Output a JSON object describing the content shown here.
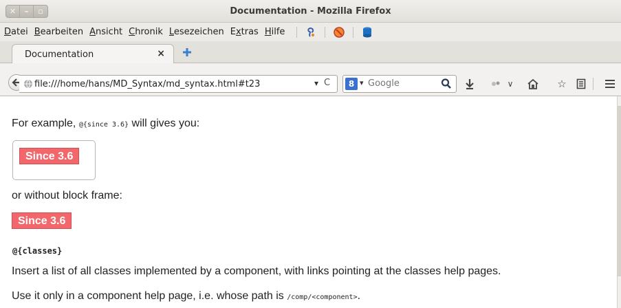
{
  "window": {
    "title": "Documentation - Mozilla Firefox"
  },
  "menubar": {
    "items": [
      {
        "pre": "",
        "u": "D",
        "post": "atei"
      },
      {
        "pre": "",
        "u": "B",
        "post": "earbeiten"
      },
      {
        "pre": "",
        "u": "A",
        "post": "nsicht"
      },
      {
        "pre": "",
        "u": "C",
        "post": "hronik"
      },
      {
        "pre": "",
        "u": "L",
        "post": "esezeichen"
      },
      {
        "pre": "E",
        "u": "x",
        "post": "tras"
      },
      {
        "pre": "",
        "u": "H",
        "post": "ilfe"
      }
    ]
  },
  "tab": {
    "title": "Documentation",
    "close": "×"
  },
  "navbar": {
    "url": "file:///home/hans/MD_Syntax/md_syntax.html#t23",
    "url_dropdown": "▾",
    "reload": "C",
    "search_engine": "8",
    "search_placeholder": "Google"
  },
  "content": {
    "p_example_pre": "For example, ",
    "p_example_code": "@{since 3.6}",
    "p_example_post": " will gives you:",
    "badge_text": "Since 3.6",
    "p_without": "or without block frame:",
    "classes_heading": "@{classes}",
    "p_insert": "Insert a list of all classes implemented by a component, with links pointing at the classes help pages.",
    "p_use_pre": "Use it only in a component help page, i.e. whose path is ",
    "p_use_code": "/comp/<component>",
    "p_use_post": "."
  },
  "colors": {
    "badge": "#f2676b",
    "accent": "#3b6fd0"
  }
}
